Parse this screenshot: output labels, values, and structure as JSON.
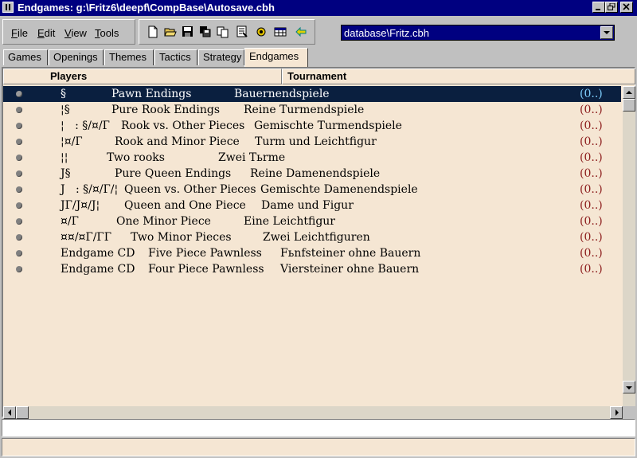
{
  "window": {
    "title": "Endgames: g:\\Fritz6\\deepf\\CompBase\\Autosave.cbh"
  },
  "menu": [
    {
      "label": "File",
      "accel": "F",
      "rest": "ile"
    },
    {
      "label": "Edit",
      "accel": "E",
      "rest": "dit"
    },
    {
      "label": "View",
      "accel": "V",
      "rest": "iew"
    },
    {
      "label": "Tools",
      "accel": "T",
      "rest": "ools"
    }
  ],
  "toolbar_icons": [
    "new-icon",
    "open-folder-icon",
    "save-icon",
    "copy-database-icon",
    "copy-icon",
    "filter-icon",
    "search-icon",
    "table-icon",
    "back-arrow-icon"
  ],
  "database_select": {
    "value": "database\\Fritz.cbh"
  },
  "tabs": [
    {
      "label": "Games",
      "active": false
    },
    {
      "label": "Openings",
      "active": false
    },
    {
      "label": "Themes",
      "active": false
    },
    {
      "label": "Tactics",
      "active": false
    },
    {
      "label": "Strategy",
      "active": false
    },
    {
      "label": "Endgames",
      "active": true
    }
  ],
  "list": {
    "headers": {
      "players": "Players",
      "tournament": "Tournament"
    },
    "rows": [
      {
        "code": "§",
        "english": "Pawn Endings",
        "german": "Bauernendspiele",
        "count": "(0..)",
        "selected": true
      },
      {
        "code": "¦§",
        "english": "Pure Rook Endings",
        "german": "Reine Turmendspiele",
        "count": "(0..)",
        "selected": false
      },
      {
        "code": "¦   : §/¤/Г",
        "english": "Rook vs. Other Pieces",
        "german": "Gemischte Turmendspiele",
        "count": "(0..)",
        "selected": false
      },
      {
        "code": "¦¤/Г",
        "english": "Rook and Minor Piece",
        "german": "Turm und Leichtfigur",
        "count": "(0..)",
        "selected": false
      },
      {
        "code": "¦¦",
        "english": "Two rooks",
        "german": "Zwei Tьrme",
        "count": "(0..)",
        "selected": false
      },
      {
        "code": "J§",
        "english": "Pure Queen Endings",
        "german": "Reine Damenendspiele",
        "count": "(0..)",
        "selected": false
      },
      {
        "code": "J   : §/¤/Г/¦",
        "english": "Queen vs. Other Pieces",
        "german": "Gemischte Damenendspiele",
        "count": "(0..)",
        "selected": false
      },
      {
        "code": "JГ/J¤/J¦",
        "english": "Queen and One Piece",
        "german": "Dame und Figur",
        "count": "(0..)",
        "selected": false
      },
      {
        "code": "¤/Г",
        "english": "One Minor Piece",
        "german": "Eine Leichtfigur",
        "count": "(0..)",
        "selected": false
      },
      {
        "code": "¤¤/¤Г/ГГ",
        "english": "Two Minor Pieces",
        "german": "Zwei Leichtfiguren",
        "count": "(0..)",
        "selected": false
      },
      {
        "code": "Endgame CD",
        "english": "Five Piece Pawnless",
        "german": "Fьnfsteiner ohne Bauern",
        "count": "(0..)",
        "selected": false
      },
      {
        "code": "Endgame CD",
        "english": "Four Piece Pawnless",
        "german": "Viersteiner ohne Bauern",
        "count": "(0..)",
        "selected": false
      }
    ]
  },
  "colors": {
    "titlebar": "#000080",
    "list_background": "#f5e6d3",
    "selected_row": "#0a1f3f",
    "count_text": "#8b1a1a",
    "selected_count_text": "#7fd0ff"
  }
}
